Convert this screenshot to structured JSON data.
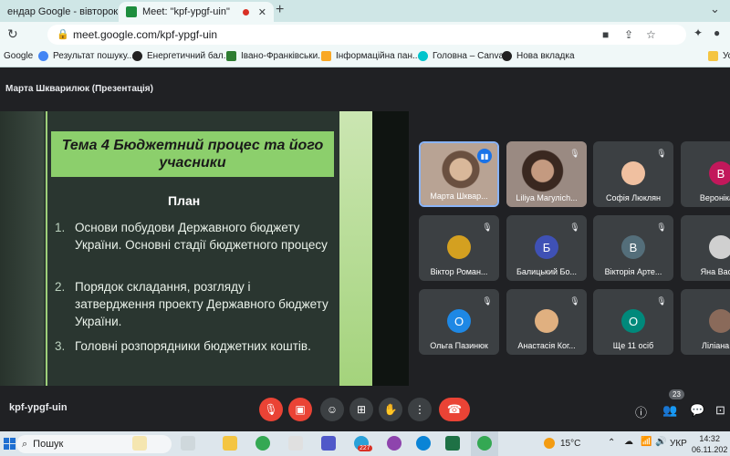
{
  "browser": {
    "tabs": [
      {
        "title": "ендар Google - вівторок, 7"
      },
      {
        "title": "Meet: \"kpf-ypgf-uin\""
      }
    ],
    "url": "meet.google.com/kpf-ypgf-uin",
    "bookmarks": [
      {
        "label": "Google"
      },
      {
        "label": "Результат пошуку..."
      },
      {
        "label": "Енергетичний бал..."
      },
      {
        "label": "Івано-Франківськи..."
      },
      {
        "label": "Інформаційна пан..."
      },
      {
        "label": "Головна – Canva"
      },
      {
        "label": "Нова вкладка"
      },
      {
        "label": "Усі"
      }
    ]
  },
  "meet": {
    "presenter_label": "Марта Шкварилюк (Презентація)",
    "meeting_code": "kpf-ypgf-uin",
    "participant_count": "23",
    "slide": {
      "title": "Тема 4 Бюджетний процес та його учасники",
      "plan_heading": "План",
      "items": [
        {
          "num": "1.",
          "text": "Основи побудови Державного бюджету України. Основні стадії бюджетного процесу"
        },
        {
          "num": "2.",
          "text": "Порядок складання, розгляду і затвердження проекту Державного бюджету України."
        },
        {
          "num": "3.",
          "text": "Головні розпорядники бюджетних коштів."
        }
      ]
    },
    "participants": [
      {
        "name": "Марта Шквар...",
        "initial": "",
        "avatar_color": "#c8a080"
      },
      {
        "name": "Liliya Maгуліch...",
        "initial": "",
        "avatar_color": "#a08068"
      },
      {
        "name": "Софія Люклян",
        "initial": "",
        "avatar_color": "#f0c0a0"
      },
      {
        "name": "Вероніка Н",
        "initial": "В",
        "avatar_color": "#c2185b"
      },
      {
        "name": "Віктор Роман...",
        "initial": "",
        "avatar_color": "#d4a020"
      },
      {
        "name": "Балицький Бо...",
        "initial": "Б",
        "avatar_color": "#3f51b5"
      },
      {
        "name": "Вікторія Арте...",
        "initial": "В",
        "avatar_color": "#546e7a"
      },
      {
        "name": "Яна Васил",
        "initial": "",
        "avatar_color": "#d0d0d0"
      },
      {
        "name": "Ольга Пазинюк",
        "initial": "О",
        "avatar_color": "#1e88e5"
      },
      {
        "name": "Анастасія Ког...",
        "initial": "",
        "avatar_color": "#e0b080"
      },
      {
        "name": "Ще 11 осіб",
        "initial": "О",
        "avatar_color": "#00897b"
      },
      {
        "name": "Ліліана Го",
        "initial": "",
        "avatar_color": "#8a6a5a"
      }
    ]
  },
  "taskbar": {
    "search_label": "Пошук",
    "mail_badge": "227",
    "weather": "15°C",
    "language": "УКР",
    "time": "14:32",
    "date": "06.11.202"
  }
}
